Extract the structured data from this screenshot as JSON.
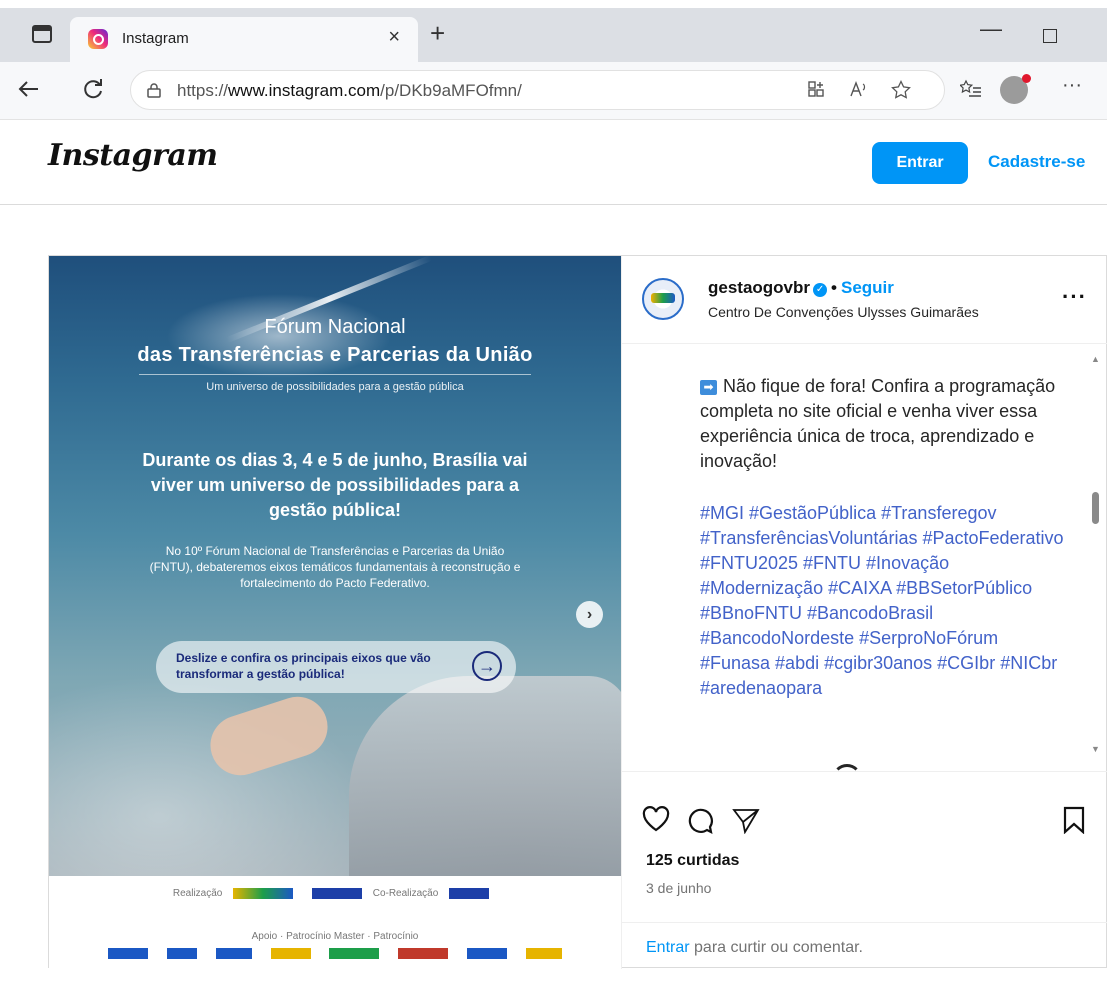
{
  "browser": {
    "tab_title": "Instagram",
    "tab_close": "×",
    "new_tab": "+",
    "url_prefix": "https://",
    "url_main": "www.instagram.com",
    "url_path": "/p/DKb9aMFOfmn/",
    "window_min": "—",
    "menu": "···"
  },
  "header": {
    "logo": "Instagram",
    "login_button": "Entrar",
    "signup_link": "Cadastre-se"
  },
  "post_image": {
    "title_line1": "Fórum Nacional",
    "title_line2": "das Transferências e Parcerias da União",
    "subtitle": "Um universo de possibilidades para a gestão pública",
    "headline": "Durante os dias 3, 4 e 5 de junho, Brasília vai viver um universo de possibilidades para a gestão pública!",
    "body": "No 10º Fórum Nacional de Transferências e Parcerias da União (FNTU), debateremos eixos temáticos fundamentais à reconstrução e fortalecimento do Pacto Federativo.",
    "cta": "Deslize e confira os principais eixos que vão transformar a gestão pública!",
    "sponsor_row1_left": "Realização",
    "sponsor_row1_right": "Co-Realização",
    "sponsor_row2": "Apoio · Patrocínio Master · Patrocínio"
  },
  "author": {
    "username": "gestaogovbr",
    "follow": "Seguir",
    "location": "Centro De Convenções Ulysses Guimarães",
    "more": "···"
  },
  "caption": {
    "text": "Não fique de fora! Confira a programação completa no site oficial e venha viver essa experiência única de troca, aprendizado e inovação!",
    "hashtags": "#MGI #GestãoPública #Transferegov #TransferênciasVoluntárias #PactoFederativo #FNTU2025 #FNTU #Inovação #Modernização #CAIXA #BBSetorPúblico #BBnoFNTU #BancodoBrasil #BancodoNordeste #SerproNoFórum #Funasa #abdi #cgibr30anos #CGIbr #NICbr #aredenaopara"
  },
  "stats": {
    "likes": "125 curtidas",
    "date": "3 de junho",
    "login_link": "Entrar",
    "login_rest": " para curtir ou comentar."
  },
  "colors": {
    "accent": "#0095f6",
    "hashtag": "#4262c9"
  }
}
